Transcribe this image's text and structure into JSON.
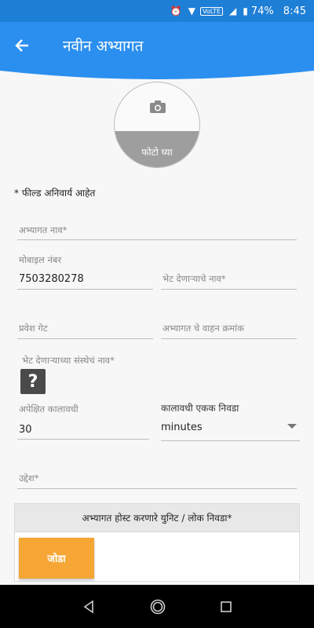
{
  "status_bar": {
    "volte": "VoLTE",
    "battery": "74%",
    "time": "8:45"
  },
  "app_bar": {
    "title": "नवीन अभ्यागत"
  },
  "photo": {
    "label": "फोटो घ्या"
  },
  "required_note": "* फील्ड अनिवार्य आहेत",
  "fields": {
    "visitor_name": {
      "label": "अभ्यागत नाव*",
      "value": ""
    },
    "mobile": {
      "label": "मोबाइल नंबर",
      "value": "7503280278"
    },
    "host_name": {
      "label": "भेट देणाऱ्याचे नाव*",
      "value": ""
    },
    "entry_gate": {
      "label": "प्रवेश गेट",
      "value": ""
    },
    "vehicle_number": {
      "label": "अभ्यागत चे वाहन क्रमांक",
      "value": ""
    },
    "org_name": {
      "label": "भेट देणाऱ्याच्या संस्थेचं नाव*",
      "value": ""
    },
    "expected_duration": {
      "label": "अपेक्षित कालावधी",
      "value": "30"
    },
    "purpose": {
      "label": "उद्देश*",
      "value": ""
    }
  },
  "duration_unit": {
    "label": "कालावधी एकक निवडा",
    "selected": "minutes"
  },
  "host_panel": {
    "title": "अभ्यागत होस्ट करणारे युनिट / लोक निवडा*",
    "add_label": "जोडा"
  },
  "colors": {
    "primary": "#2b8ff0",
    "status": "#1e7fd6",
    "accent": "#f5a635"
  }
}
